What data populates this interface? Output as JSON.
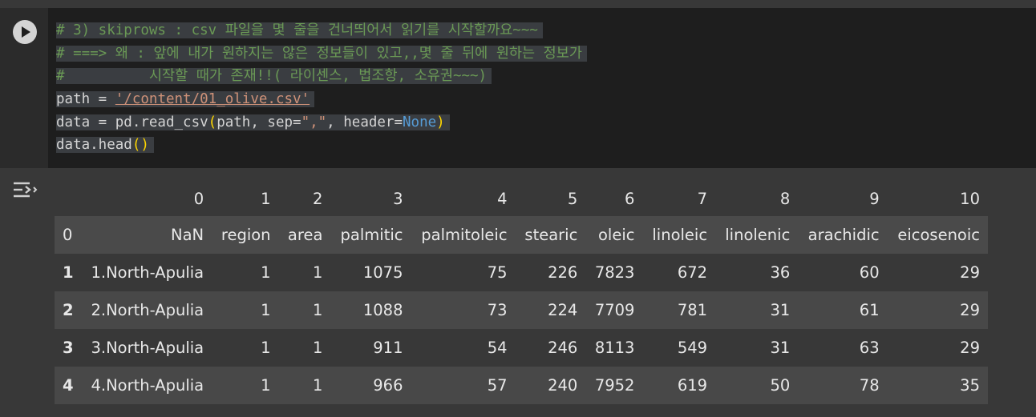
{
  "code": {
    "lines": [
      [
        {
          "t": "# 3) skiprows : csv 파일을 몇 줄을 건너띄어서 읽기를 시작할까요~~~",
          "c": "cm"
        }
      ],
      [
        {
          "t": "# ===> 왜 : 앞에 내가 원하지는 않은 정보들이 있고,,몇 줄 뒤에 원하는 정보가",
          "c": "cm"
        }
      ],
      [
        {
          "t": "#          시작할 때가 존재!!( 라이센스, 법조항, 소유권~~~)",
          "c": "cm"
        }
      ],
      [
        {
          "t": "path = ",
          "c": ""
        },
        {
          "t": "'/content/01_olive.csv'",
          "c": "str-link"
        }
      ],
      [
        {
          "t": "data = pd.read_csv",
          "c": ""
        },
        {
          "t": "(",
          "c": "par"
        },
        {
          "t": "path, sep=",
          "c": ""
        },
        {
          "t": "\",\"",
          "c": "str"
        },
        {
          "t": ", header=",
          "c": ""
        },
        {
          "t": "None",
          "c": "kw"
        },
        {
          "t": ")",
          "c": "par"
        }
      ],
      [
        {
          "t": "data.head",
          "c": ""
        },
        {
          "t": "()",
          "c": "par"
        }
      ]
    ]
  },
  "output": {
    "column_numbers": [
      "",
      "0",
      "1",
      "2",
      "3",
      "4",
      "5",
      "6",
      "7",
      "8",
      "9",
      "10"
    ],
    "header_row": {
      "index": "0",
      "cells": [
        "NaN",
        "region",
        "area",
        "palmitic",
        "palmitoleic",
        "stearic",
        "oleic",
        "linoleic",
        "linolenic",
        "arachidic",
        "eicosenoic"
      ]
    },
    "rows": [
      {
        "index": "1",
        "cells": [
          "1.North-Apulia",
          "1",
          "1",
          "1075",
          "75",
          "226",
          "7823",
          "672",
          "36",
          "60",
          "29"
        ]
      },
      {
        "index": "2",
        "cells": [
          "2.North-Apulia",
          "1",
          "1",
          "1088",
          "73",
          "224",
          "7709",
          "781",
          "31",
          "61",
          "29"
        ]
      },
      {
        "index": "3",
        "cells": [
          "3.North-Apulia",
          "1",
          "1",
          "911",
          "54",
          "246",
          "8113",
          "549",
          "31",
          "63",
          "29"
        ]
      },
      {
        "index": "4",
        "cells": [
          "4.North-Apulia",
          "1",
          "1",
          "966",
          "57",
          "240",
          "7952",
          "619",
          "50",
          "78",
          "35"
        ]
      }
    ]
  },
  "icons": {
    "run": "play-icon",
    "output": "output-toggle-icon"
  }
}
